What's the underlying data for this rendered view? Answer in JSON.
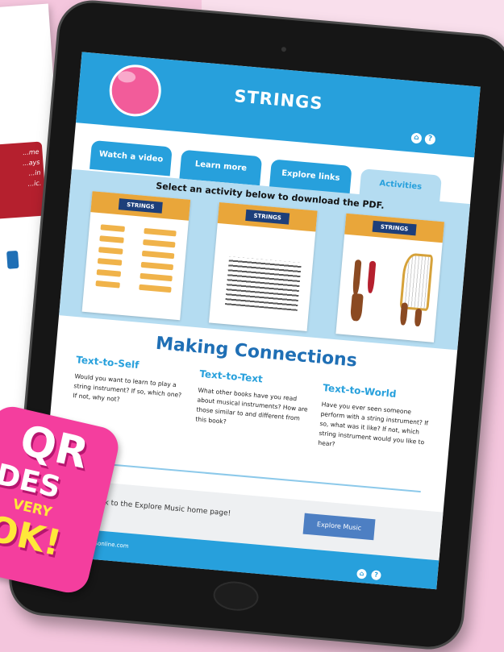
{
  "background": {
    "color": "#f4c6dd"
  },
  "paper": {
    "note_text": "...me\n...ays\n...in\n...ic."
  },
  "sticker": {
    "line1": "QR",
    "line2": "DES",
    "line3": "VERY",
    "line4": "OK!"
  },
  "page": {
    "title": "STRINGS",
    "header_icons": [
      "home-icon",
      "help-icon"
    ],
    "tabs": [
      {
        "label": "Watch a video",
        "active": false
      },
      {
        "label": "Learn more",
        "active": false
      },
      {
        "label": "Explore links",
        "active": false
      },
      {
        "label": "Activities",
        "active": true
      }
    ],
    "activities": {
      "instruction": "Select an activity below to download the PDF.",
      "sheets": [
        {
          "title": "STRINGS",
          "kind": "matching"
        },
        {
          "title": "STRINGS",
          "kind": "word-search"
        },
        {
          "title": "STRINGS",
          "kind": "instruments"
        }
      ]
    },
    "connections": {
      "heading": "Making Connections",
      "columns": [
        {
          "title": "Text-to-Self",
          "body": "Would you want to learn to play a string instrument? If so, which one? If not, why not?"
        },
        {
          "title": "Text-to-Text",
          "body": "What other books have you read about musical instruments? How are those similar to and different from this book?"
        },
        {
          "title": "Text-to-World",
          "body": "Have you ever seen someone perform with a string instrument? If so, what was it like? If not, which string instrument would you like to hear?"
        }
      ]
    },
    "footer_bar": {
      "message": "here to head back to the Explore Music home page!",
      "button_label": "Explore Music"
    },
    "footer": {
      "copyright": "right 2022 popbooksonline.com",
      "icons": [
        "home-icon",
        "help-icon"
      ]
    }
  },
  "colors": {
    "primary": "#27a0dc",
    "accent_pink": "#f43e9e",
    "panel": "#b4dcf1"
  }
}
